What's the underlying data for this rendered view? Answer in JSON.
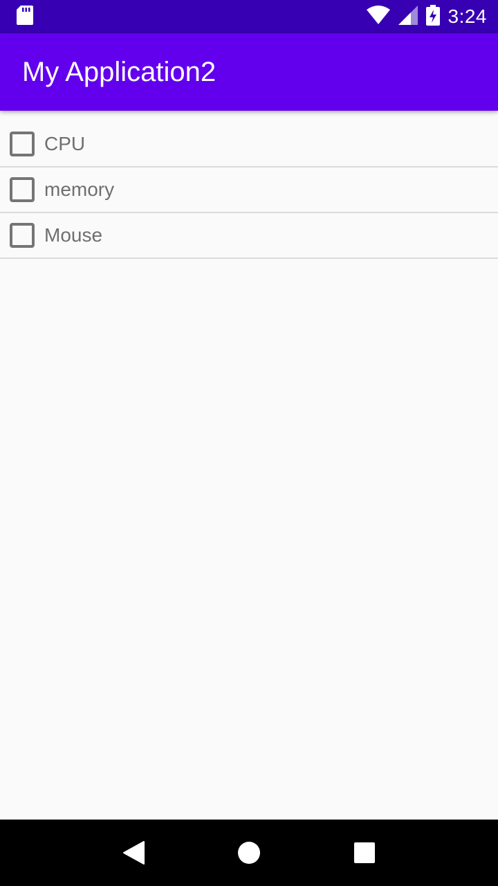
{
  "status_bar": {
    "time": "3:24",
    "icons": [
      "sd-card-icon",
      "wifi-icon",
      "signal-icon",
      "battery-charging-icon"
    ]
  },
  "app_bar": {
    "title": "My Application2",
    "color": "#6200ee"
  },
  "list": {
    "items": [
      {
        "label": "CPU",
        "checked": false
      },
      {
        "label": "memory",
        "checked": false
      },
      {
        "label": "Mouse",
        "checked": false
      }
    ]
  },
  "nav_bar": {
    "buttons": [
      "back-icon",
      "home-icon",
      "recents-icon"
    ]
  },
  "colors": {
    "status_bar": "#3700b3",
    "app_bar": "#6200ee",
    "background": "#fafafa"
  }
}
